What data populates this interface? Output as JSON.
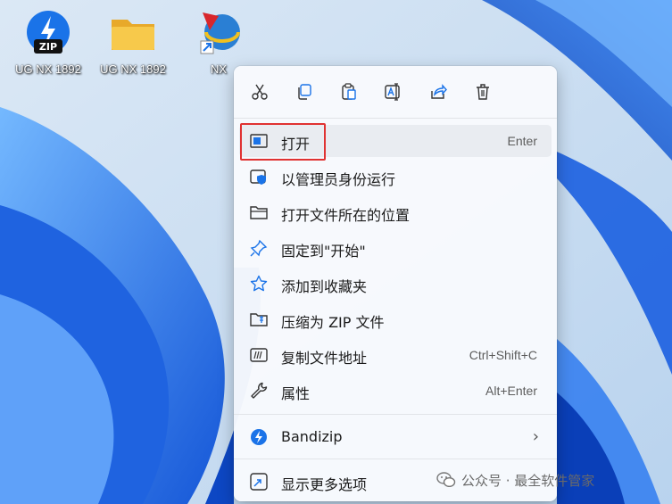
{
  "desktop": {
    "icons": [
      {
        "label": "UG NX 1892",
        "icon": "zip-archive-icon",
        "badge": "ZIP"
      },
      {
        "label": "UG NX 1892",
        "icon": "folder-icon"
      },
      {
        "label": "NX",
        "icon": "nx-app-shortcut-icon"
      }
    ]
  },
  "menu": {
    "toolbar": [
      {
        "icon": "cut-icon"
      },
      {
        "icon": "copy-icon"
      },
      {
        "icon": "paste-icon"
      },
      {
        "icon": "rename-icon"
      },
      {
        "icon": "share-icon"
      },
      {
        "icon": "delete-icon"
      }
    ],
    "items": [
      {
        "label": "打开",
        "shortcut": "Enter",
        "icon": "open-window-icon"
      },
      {
        "label": "以管理员身份运行",
        "icon": "admin-shield-icon"
      },
      {
        "label": "打开文件所在的位置",
        "icon": "folder-outline-icon"
      },
      {
        "label": "固定到\"开始\"",
        "icon": "pin-icon"
      },
      {
        "label": "添加到收藏夹",
        "icon": "star-icon"
      },
      {
        "label": "压缩为 ZIP 文件",
        "icon": "zip-folder-icon"
      },
      {
        "label": "复制文件地址",
        "shortcut": "Ctrl+Shift+C",
        "icon": "copy-path-icon"
      },
      {
        "label": "属性",
        "shortcut": "Alt+Enter",
        "icon": "wrench-icon"
      },
      {
        "label": "Bandizip",
        "icon": "bandizip-icon",
        "submenu": "›"
      },
      {
        "label": "显示更多选项",
        "icon": "more-options-icon"
      }
    ]
  },
  "watermark": {
    "text": "公众号 · 最全软件管家"
  },
  "colors": {
    "accent": "#1a73e8",
    "highlight_border": "#e03232",
    "menu_bg": "#f8fafd"
  }
}
